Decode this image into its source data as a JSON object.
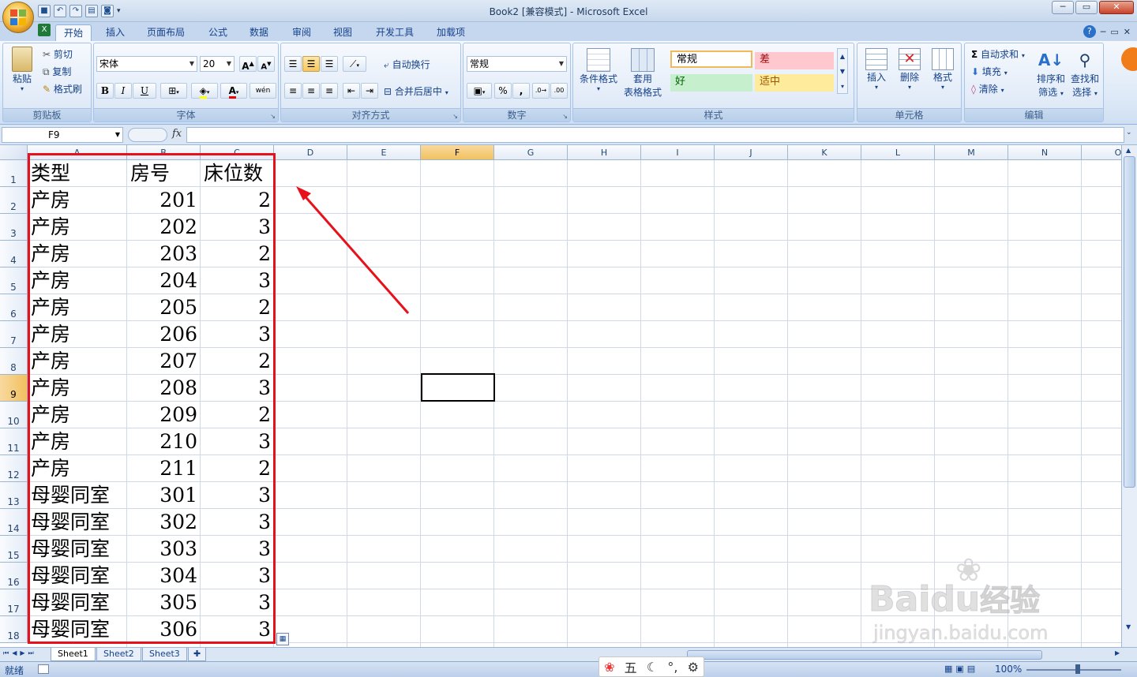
{
  "window": {
    "title": "Book2  [兼容模式] - Microsoft Excel",
    "qat_icons": [
      "save-icon",
      "undo-icon",
      "redo-icon",
      "print-preview-icon",
      "camera-icon"
    ],
    "controls": {
      "minimize": "─",
      "restore": "▭",
      "close": "✕"
    },
    "inner_controls": {
      "minimize": "─",
      "restore": "▭",
      "close": "✕"
    }
  },
  "tabs": [
    "开始",
    "插入",
    "页面布局",
    "公式",
    "数据",
    "审阅",
    "视图",
    "开发工具",
    "加载项"
  ],
  "active_tab": "开始",
  "ribbon": {
    "clipboard": {
      "label": "剪贴板",
      "paste": "粘贴",
      "cut": "剪切",
      "copy": "复制",
      "format_painter": "格式刷"
    },
    "font": {
      "label": "字体",
      "name": "宋体",
      "size": "20",
      "bold": "B",
      "italic": "I",
      "underline": "U",
      "grow": "A",
      "shrink": "A",
      "wen": "wén"
    },
    "alignment": {
      "label": "对齐方式",
      "wrap": "自动换行",
      "merge": "合并后居中"
    },
    "number": {
      "label": "数字",
      "format": "常规",
      "percent": "%",
      "comma": ","
    },
    "styles": {
      "label": "样式",
      "conditional": "条件格式",
      "table_line1": "套用",
      "table_line2": "表格格式",
      "cells": [
        {
          "text": "常规",
          "bg": "#ffffff"
        },
        {
          "text": "差",
          "bg": "#ffc7ce",
          "color": "#9c0006"
        },
        {
          "text": "好",
          "bg": "#c6efce",
          "color": "#006100"
        },
        {
          "text": "适中",
          "bg": "#ffeb9c",
          "color": "#9c5700"
        }
      ]
    },
    "cells_group": {
      "label": "单元格",
      "insert": "插入",
      "delete": "删除",
      "format": "格式"
    },
    "editing": {
      "label": "编辑",
      "autosum": "自动求和",
      "fill": "填充",
      "clear": "清除",
      "sort_line1": "排序和",
      "sort_line2": "筛选",
      "find_line1": "查找和",
      "find_line2": "选择"
    }
  },
  "formula_bar": {
    "name_box": "F9",
    "fx": "fx",
    "content": ""
  },
  "sheet": {
    "columns": [
      "A",
      "B",
      "C",
      "D",
      "E",
      "F",
      "G",
      "H",
      "I",
      "J",
      "K",
      "L",
      "M",
      "N",
      "O"
    ],
    "selected_column": "F",
    "selected_row": "9",
    "selected_cell": "F9",
    "rows": [
      {
        "n": "1",
        "a": "类型",
        "b": "房号",
        "c": "床位数"
      },
      {
        "n": "2",
        "a": "产房",
        "b": "201",
        "c": "2"
      },
      {
        "n": "3",
        "a": "产房",
        "b": "202",
        "c": "3"
      },
      {
        "n": "4",
        "a": "产房",
        "b": "203",
        "c": "2"
      },
      {
        "n": "5",
        "a": "产房",
        "b": "204",
        "c": "3"
      },
      {
        "n": "6",
        "a": "产房",
        "b": "205",
        "c": "2"
      },
      {
        "n": "7",
        "a": "产房",
        "b": "206",
        "c": "3"
      },
      {
        "n": "8",
        "a": "产房",
        "b": "207",
        "c": "2"
      },
      {
        "n": "9",
        "a": "产房",
        "b": "208",
        "c": "3"
      },
      {
        "n": "10",
        "a": "产房",
        "b": "209",
        "c": "2"
      },
      {
        "n": "11",
        "a": "产房",
        "b": "210",
        "c": "3"
      },
      {
        "n": "12",
        "a": "产房",
        "b": "211",
        "c": "2"
      },
      {
        "n": "13",
        "a": "母婴同室",
        "b": "301",
        "c": "3"
      },
      {
        "n": "14",
        "a": "母婴同室",
        "b": "302",
        "c": "3"
      },
      {
        "n": "15",
        "a": "母婴同室",
        "b": "303",
        "c": "3"
      },
      {
        "n": "16",
        "a": "母婴同室",
        "b": "304",
        "c": "3"
      },
      {
        "n": "17",
        "a": "母婴同室",
        "b": "305",
        "c": "3"
      },
      {
        "n": "18",
        "a": "母婴同室",
        "b": "306",
        "c": "3"
      }
    ]
  },
  "sheet_tabs": [
    "Sheet1",
    "Sheet2",
    "Sheet3"
  ],
  "active_sheet": "Sheet1",
  "status": {
    "ready": "就绪",
    "zoom": "100%"
  },
  "ime": {
    "label": "五"
  },
  "watermark": {
    "line1": "Bai",
    "line2": "du",
    "cn": "经验",
    "url": "jingyan.baidu.com"
  },
  "annotation_color": "#e8101a"
}
